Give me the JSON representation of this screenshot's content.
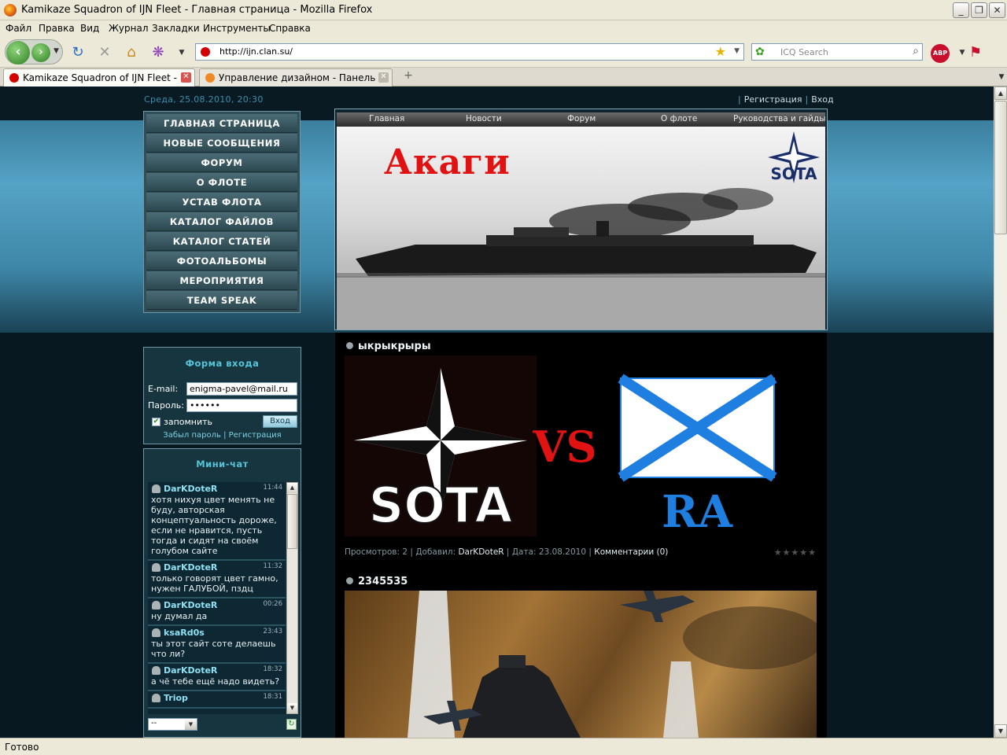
{
  "window": {
    "title": "Kamikaze Squadron of IJN Fleet - Главная страница - Mozilla Firefox",
    "minimize": "_",
    "maximize": "❐",
    "close": "✕"
  },
  "menubar": {
    "items": [
      "Файл",
      "Правка",
      "Вид",
      "Журнал",
      "Закладки",
      "Инструменты",
      "Справка"
    ]
  },
  "toolbar": {
    "url": "http://ijn.clan.su/",
    "search_placeholder": "ICQ Search",
    "adblock_label": "ABP"
  },
  "tabs": [
    {
      "label": "Kamikaze Squadron of IJN Fleet -...",
      "active": true,
      "favicon_color": "#d40000"
    },
    {
      "label": "Управление дизайном - Панель упра...",
      "active": false,
      "favicon_color": "#f08a24"
    }
  ],
  "status": {
    "text": "Готово"
  },
  "site": {
    "datetime": "Среда, 25.08.2010, 20:30",
    "top_links": [
      "Регистрация",
      "Вход"
    ],
    "menu": [
      "ГЛАВНАЯ СТРАНИЦА",
      "НОВЫЕ СООБЩЕНИЯ",
      "ФОРУМ",
      "О ФЛОТЕ",
      "УСТАВ ФЛОТА",
      "КАТАЛОГ ФАЙЛОВ",
      "КАТАЛОГ СТАТЕЙ",
      "ФОТОАЛЬБОМЫ",
      "МЕРОПРИЯТИЯ",
      "TEAM SPEAK"
    ],
    "header_nav": [
      "Главная",
      "Новости",
      "Форум",
      "О флоте",
      "Руководства и гайды"
    ],
    "header_title": "Акаги",
    "header_logo": "SOTA",
    "login": {
      "title": "Форма входа",
      "email_label": "E-mail:",
      "email_value": "enigma-pavel@mail.ru",
      "password_label": "Пароль:",
      "password_value": "••••••",
      "remember_label": "запомнить",
      "submit": "Вход",
      "forgot": "Забыл пароль",
      "register": "Регистрация"
    },
    "chat": {
      "title": "Мини-чат",
      "select_value": "--",
      "messages": [
        {
          "user": "DarKDoteR",
          "time": "11:44",
          "text": "хотя нихуя цвет менять не буду, авторская концептуальность дороже, если не нравится, пусть тогда и сидят на своём голубом сайте"
        },
        {
          "user": "DarKDoteR",
          "time": "11:32",
          "text": "только говорят цвет гамно, нужен ГАЛУБОЙ, пздц"
        },
        {
          "user": "DarKDoteR",
          "time": "00:26",
          "text": "ну думал да"
        },
        {
          "user": "ksaRd0s",
          "time": "23:43",
          "text": "ты этот сайт соте делаешь что ли?"
        },
        {
          "user": "DarKDoteR",
          "time": "18:32",
          "text": "а чё тебе ещё надо видеть?"
        },
        {
          "user": "Triop",
          "time": "18:31",
          "text": ""
        }
      ]
    },
    "posts": [
      {
        "title": "ыкрыкрыры",
        "left_logo": "SOTA",
        "vs_text": "VS",
        "right_logo": "RA",
        "meta_views_label": "Просмотров:",
        "meta_views": "2",
        "meta_added_label": "Добавил:",
        "meta_author": "DarKDoteR",
        "meta_date_label": "Дата:",
        "meta_date": "23.08.2010",
        "meta_comments": "Комментарии (0)",
        "rating_stars": "★★★★★"
      },
      {
        "title": "2345535"
      }
    ]
  },
  "colors": {
    "accent": "#56c4d8",
    "menu_bg": "#2f4e58",
    "vs_red": "#e01212",
    "ra_blue": "#1e7fe0"
  }
}
